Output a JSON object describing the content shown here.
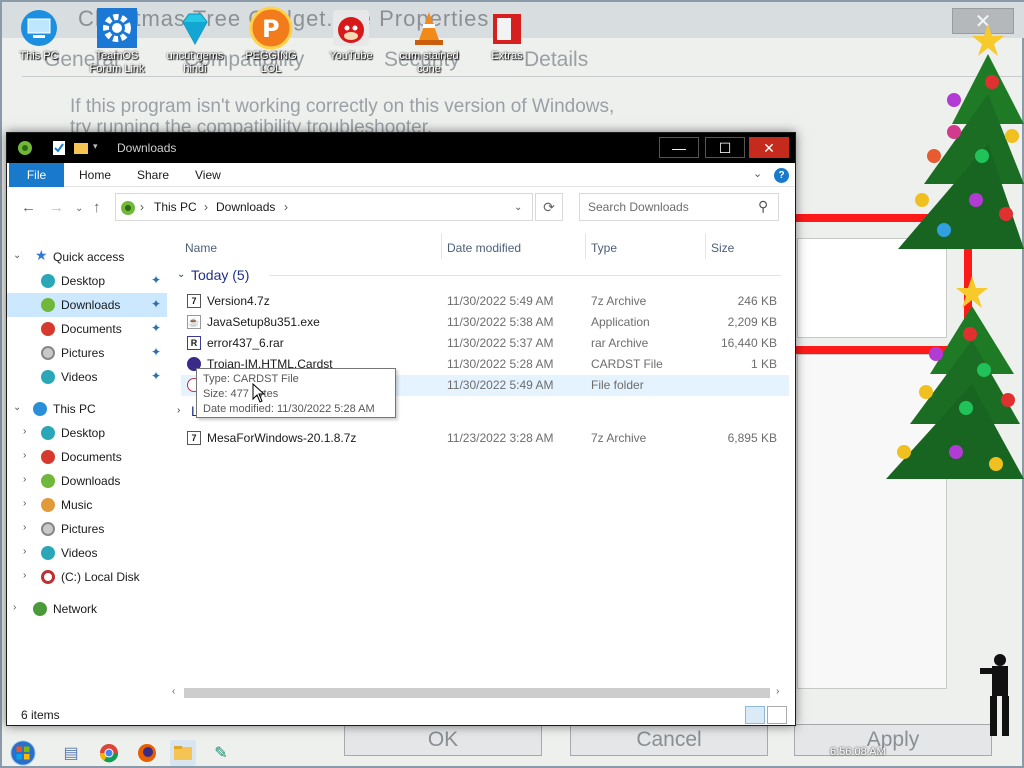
{
  "background_dialog": {
    "title": "Christmas Tree Gadget.exe Properties",
    "close_glyph": "✕",
    "tabs": [
      "General",
      "Compatibility",
      "Security",
      "Details"
    ],
    "info_line_1": "If this program isn't working correctly on this version of Windows,",
    "info_line_2": "try running the compatibility troubleshooter.",
    "ok_label": "OK",
    "cancel_label": "Cancel",
    "apply_label": "Apply"
  },
  "desktop_icons": [
    {
      "label": "This PC",
      "icon": "computer-icon"
    },
    {
      "label": "TeamOS Forum Link",
      "icon": "gear-icon"
    },
    {
      "label": "uncut gems hindi",
      "icon": "gem-icon"
    },
    {
      "label": "PEGGING LOL",
      "icon": "p-logo-icon"
    },
    {
      "label": "YouTube",
      "icon": "angry-bird-icon"
    },
    {
      "label": "cum stained cone",
      "icon": "traffic-cone-icon"
    },
    {
      "label": "Extras",
      "icon": "box-icon"
    }
  ],
  "explorer": {
    "title": "Downloads",
    "ribbon_tabs": {
      "file": "File",
      "home": "Home",
      "share": "Share",
      "view": "View"
    },
    "help_glyph": "?",
    "address": {
      "root": "This PC",
      "current": "Downloads"
    },
    "search_placeholder": "Search Downloads",
    "nav_pane": {
      "quick_access": "Quick access",
      "quick_items": [
        "Desktop",
        "Downloads",
        "Documents",
        "Pictures",
        "Videos"
      ],
      "this_pc": "This PC",
      "pc_items": [
        "Desktop",
        "Documents",
        "Downloads",
        "Music",
        "Pictures",
        "Videos",
        "(C:) Local Disk"
      ],
      "network": "Network"
    },
    "columns": {
      "name": "Name",
      "date": "Date modified",
      "type": "Type",
      "size": "Size"
    },
    "groups": {
      "today": "Today (5)",
      "last": "L"
    },
    "today_files": [
      {
        "name": "Version4.7z",
        "date": "11/30/2022 5:49 AM",
        "type": "7z Archive",
        "size": "246 KB",
        "icon": "archive-icon"
      },
      {
        "name": "JavaSetup8u351.exe",
        "date": "11/30/2022 5:38 AM",
        "type": "Application",
        "size": "2,209 KB",
        "icon": "application-icon"
      },
      {
        "name": "error437_6.rar",
        "date": "11/30/2022 5:37 AM",
        "type": "rar Archive",
        "size": "16,440 KB",
        "icon": "archive-icon"
      },
      {
        "name": "Trojan-IM.HTML.Cardst",
        "date": "11/30/2022 5:28 AM",
        "type": "CARDST File",
        "size": "1 KB",
        "icon": "cardst-icon"
      },
      {
        "name": "",
        "date": "11/30/2022 5:49 AM",
        "type": "File folder",
        "size": "",
        "icon": "folder-icon"
      }
    ],
    "last_files": [
      {
        "name": "MesaForWindows-20.1.8.7z",
        "date": "11/23/2022 3:28 AM",
        "type": "7z Archive",
        "size": "6,895 KB",
        "icon": "archive-icon"
      }
    ],
    "tooltip": {
      "type_line": "Type: CARDST File",
      "size_line": "Size: 477 bytes",
      "date_line": "Date modified: 11/30/2022 5:28 AM"
    },
    "status": "6 items"
  },
  "taskbar": {
    "icons": [
      "start-orb-icon",
      "task-view-icon",
      "chrome-icon",
      "firefox-icon",
      "file-explorer-icon",
      "app-icon"
    ],
    "tray_time": "6:56:08 AM"
  },
  "colors": {
    "accent": "#1979ca",
    "selection": "#cce8ff",
    "hover": "#e5f3ff",
    "group_header": "#1e3287",
    "bg_red_frame": "#ff1a1a"
  }
}
